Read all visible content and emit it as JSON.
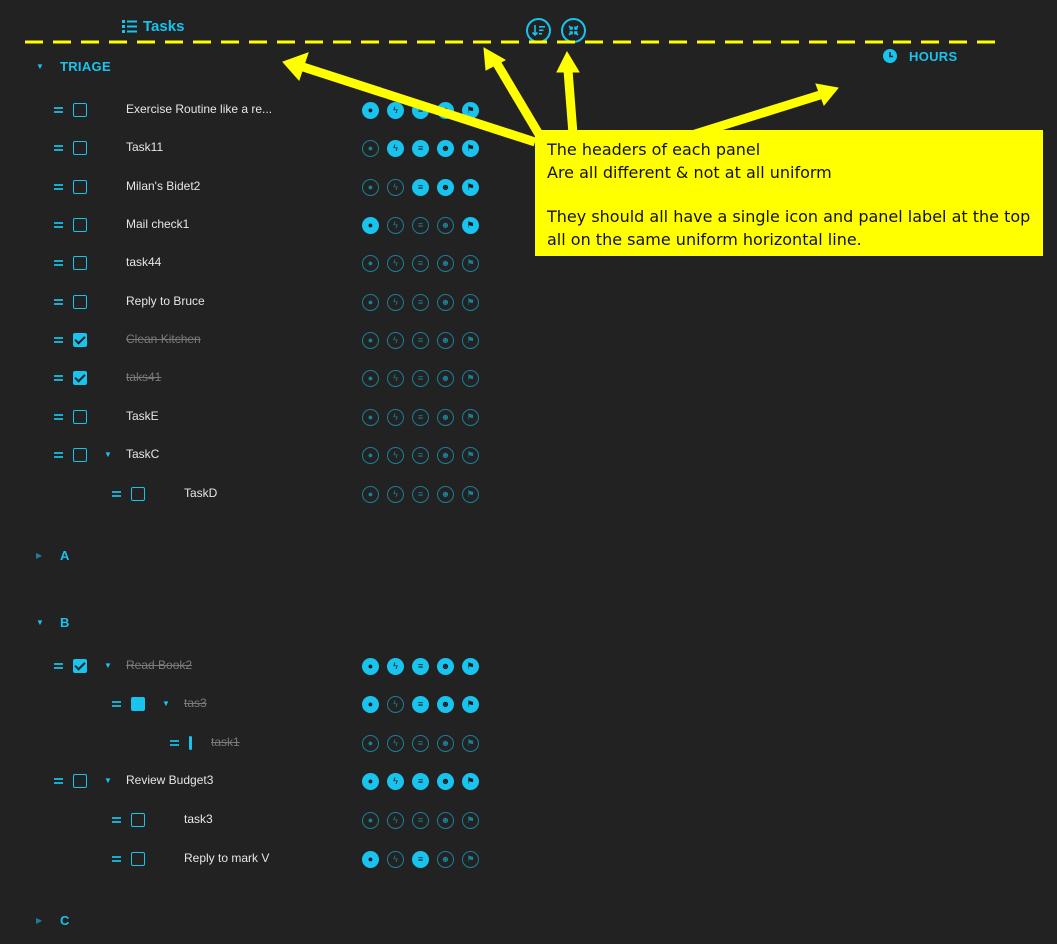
{
  "header": {
    "tasks_label": "Tasks",
    "hours_label": "HOURS",
    "sort_button_icon": "sort-icon",
    "collapse_button_icon": "collapse-icon"
  },
  "colors": {
    "accent": "#18c3ee",
    "background": "#222222",
    "annotation": "#ffff00"
  },
  "sections": [
    {
      "label": "TRIAGE",
      "expanded": true
    },
    {
      "label": "A",
      "expanded": false
    },
    {
      "label": "B",
      "expanded": true
    },
    {
      "label": "C",
      "expanded": false
    }
  ],
  "tasks": [
    {
      "name": "Exercise Routine like a re...",
      "done": false,
      "icons": [
        true,
        true,
        true,
        true,
        true
      ]
    },
    {
      "name": "Task11",
      "done": false,
      "icons": [
        false,
        true,
        true,
        true,
        true
      ]
    },
    {
      "name": "Milan's Bidet2",
      "done": false,
      "icons": [
        false,
        false,
        true,
        true,
        true
      ]
    },
    {
      "name": "Mail check1",
      "done": false,
      "icons": [
        true,
        false,
        false,
        false,
        true
      ]
    },
    {
      "name": "task44",
      "done": false,
      "icons": [
        false,
        false,
        false,
        false,
        false
      ]
    },
    {
      "name": "Reply to Bruce",
      "done": false,
      "icons": [
        false,
        false,
        false,
        false,
        false
      ]
    },
    {
      "name": "Clean Kitchen",
      "done": true,
      "icons": [
        false,
        false,
        false,
        false,
        false
      ]
    },
    {
      "name": "taks41",
      "done": true,
      "icons": [
        false,
        false,
        false,
        false,
        false
      ]
    },
    {
      "name": "TaskE",
      "done": false,
      "icons": [
        false,
        false,
        false,
        false,
        false
      ]
    },
    {
      "name": "TaskC",
      "done": false,
      "icons": [
        false,
        false,
        false,
        false,
        false
      ]
    },
    {
      "name": "TaskD",
      "done": false,
      "icons": [
        false,
        false,
        false,
        false,
        false
      ]
    },
    {
      "name": "Read Book2",
      "done": true,
      "icons": [
        true,
        true,
        true,
        true,
        true
      ]
    },
    {
      "name": "tas3",
      "done": true,
      "icons": [
        true,
        false,
        true,
        true,
        true
      ]
    },
    {
      "name": "task1",
      "done": true,
      "icons": [
        false,
        false,
        false,
        false,
        false
      ]
    },
    {
      "name": "Review Budget3",
      "done": false,
      "icons": [
        true,
        true,
        true,
        true,
        true
      ]
    },
    {
      "name": "task3",
      "done": false,
      "icons": [
        false,
        false,
        false,
        false,
        false
      ]
    },
    {
      "name": "Reply to mark V",
      "done": false,
      "icons": [
        true,
        false,
        true,
        false,
        false
      ]
    }
  ],
  "task_icon_names": [
    "flame-icon",
    "bolt-icon",
    "list-icon",
    "face-icon",
    "flag-icon"
  ],
  "annotation": {
    "line1": "The headers of each panel",
    "line2": "Are all different & not at all uniform",
    "line3": "They should all have a single icon and panel label at the top",
    "line4": "all on the same uniform horizontal line."
  }
}
